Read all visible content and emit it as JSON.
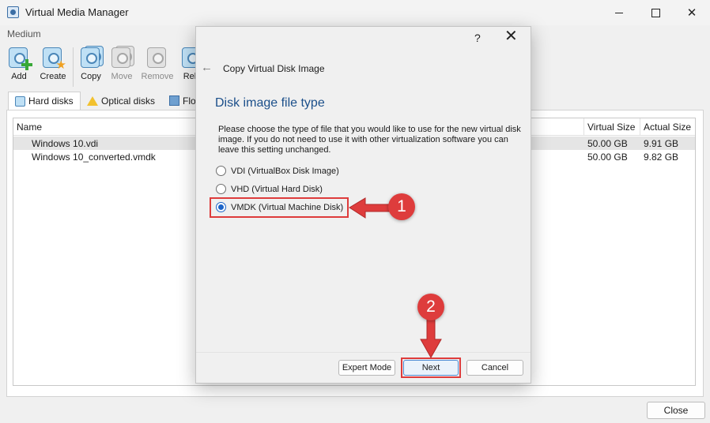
{
  "window": {
    "title": "Virtual Media Manager",
    "close_glyph": "✕"
  },
  "menu": {
    "medium": "Medium"
  },
  "toolbar": {
    "add": "Add",
    "create": "Create",
    "copy": "Copy",
    "move": "Move",
    "remove": "Remove",
    "release": "Rel"
  },
  "tabs": {
    "hard_disks": "Hard disks",
    "optical_disks": "Optical disks",
    "floppy_disks": "Flo"
  },
  "list": {
    "columns": {
      "name": "Name",
      "virtual_size": "Virtual Size",
      "actual_size": "Actual Size"
    },
    "rows": [
      {
        "name": "Windows 10.vdi",
        "virtual_size": "50.00 GB",
        "actual_size": "9.91 GB"
      },
      {
        "name": "Windows 10_converted.vmdk",
        "virtual_size": "50.00 GB",
        "actual_size": "9.82 GB"
      }
    ]
  },
  "footer": {
    "close": "Close"
  },
  "dialog": {
    "help": "?",
    "close": "✕",
    "back": "←",
    "wizard_title": "Copy Virtual Disk Image",
    "heading": "Disk image file type",
    "description": "Please choose the type of file that you would like to use for the new virtual disk image. If you do not need to use it with other virtualization software you can leave this setting unchanged.",
    "options": [
      {
        "label": "VDI (VirtualBox Disk Image)",
        "checked": false
      },
      {
        "label": "VHD (Virtual Hard Disk)",
        "checked": false
      },
      {
        "label": "VMDK (Virtual Machine Disk)",
        "checked": true
      }
    ],
    "buttons": {
      "expert": "Expert Mode",
      "next": "Next",
      "cancel": "Cancel"
    }
  },
  "annotations": {
    "step1": "1",
    "step2": "2",
    "color": "#de3c3c"
  }
}
